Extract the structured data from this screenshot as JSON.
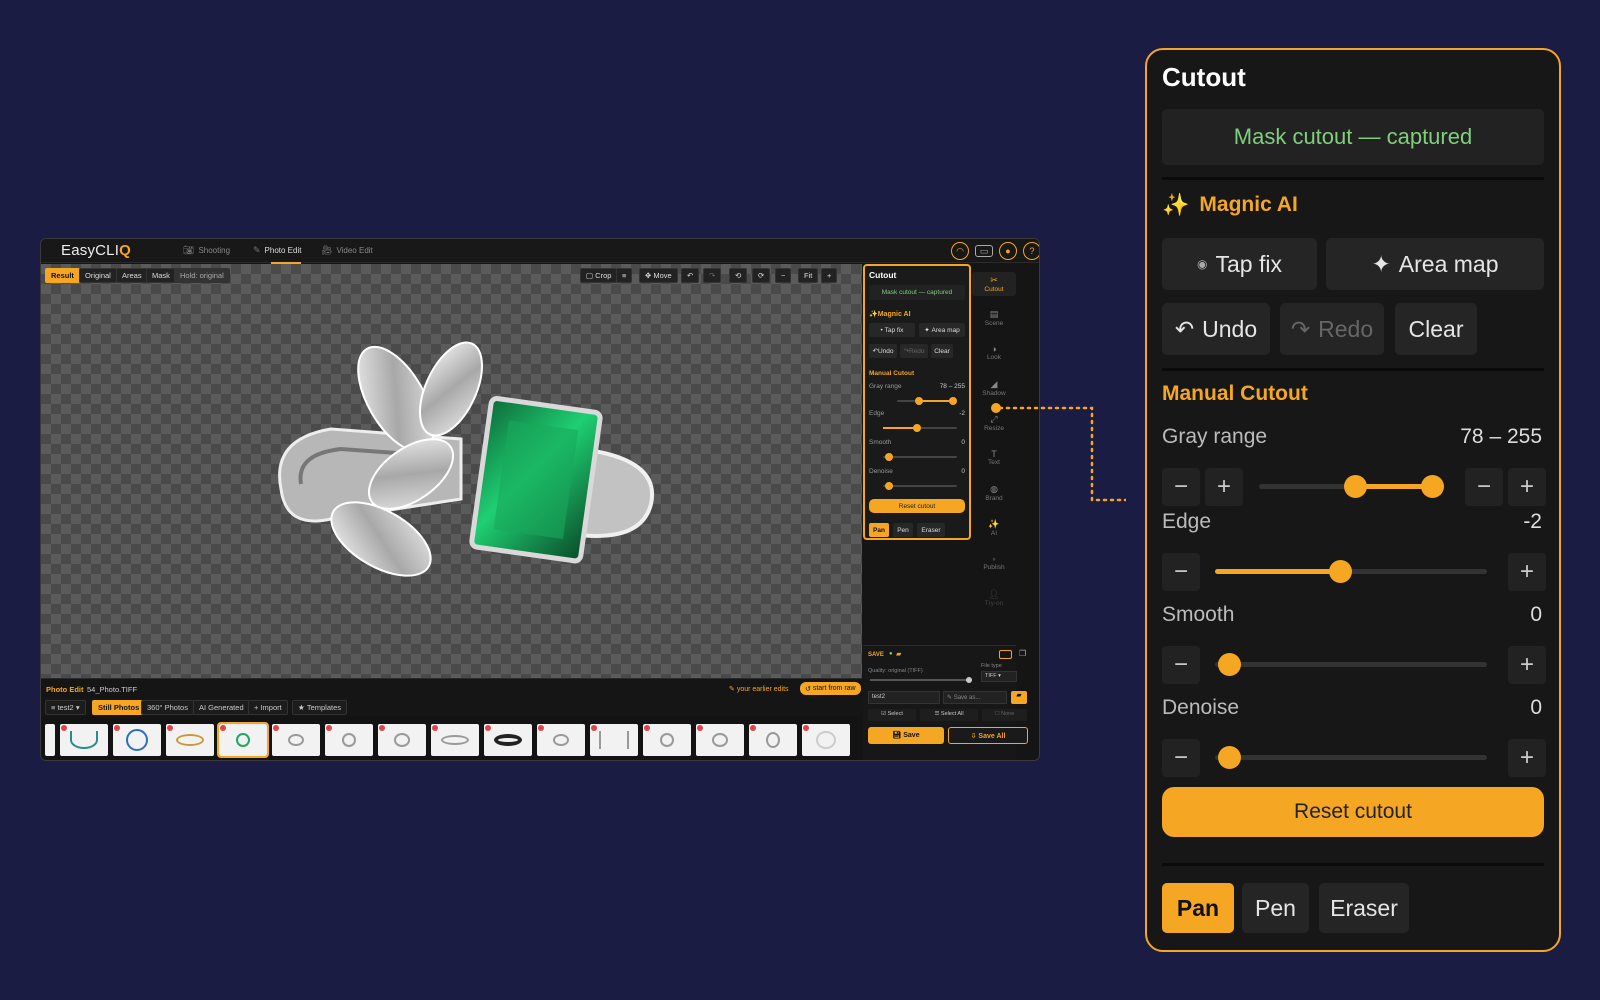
{
  "app": {
    "logo_text": "EasyCLI",
    "logo_accent": "Q",
    "nav": [
      {
        "label": "Shooting"
      },
      {
        "label": "Photo Edit"
      },
      {
        "label": "Video Edit"
      }
    ],
    "canvas_toolbar": {
      "result": "Result",
      "original": "Original",
      "areas": "Areas",
      "mask": "Mask",
      "hold_hint": "Hold: original",
      "crop": "Crop",
      "move": "Move",
      "fit": "Fit"
    },
    "info_bar": {
      "mode": "Photo Edit",
      "filename": "54_Photo.TIFF",
      "earlier_edits": "your earlier edits",
      "start_from_raw": "start from raw"
    },
    "filters": {
      "folder": "test2",
      "tabs": [
        "Still Photos",
        "360° Photos",
        "AI Generated",
        "Import",
        "Templates"
      ]
    },
    "mini_panel": {
      "title": "Cutout",
      "status": "Mask cutout — captured",
      "magic_ai": "Magnic AI",
      "tap_fix": "Tap fix",
      "area_map": "Area map",
      "undo": "Undo",
      "redo": "Redo",
      "clear": "Clear",
      "manual": "Manual Cutout",
      "gray_range": "Gray range",
      "gray_val": "78 – 255",
      "edge": "Edge",
      "edge_val": "-2",
      "smooth": "Smooth",
      "smooth_val": "0",
      "denoise": "Denoise",
      "denoise_val": "0",
      "reset": "Reset cutout",
      "pan": "Pan",
      "pen": "Pen",
      "eraser": "Eraser"
    },
    "sidebar": [
      "Cutout",
      "Scene",
      "Look",
      "Shadow",
      "Resize",
      "Text",
      "Brand",
      "AI",
      "Publish",
      "Try-on"
    ],
    "save_panel": {
      "title": "SAVE",
      "quality": "Quality: original (TIFF)",
      "file_type_label": "File type",
      "file_type": "TIFF",
      "folder": "test2",
      "save_as": "Save as...",
      "select": "Select",
      "select_all": "Select All",
      "none": "None",
      "save": "Save",
      "save_all": "Save All"
    }
  },
  "cutout_panel": {
    "title": "Cutout",
    "status": "Mask cutout — captured",
    "magic_ai": "Magnic AI",
    "tap_fix": "Tap fix",
    "area_map": "Area map",
    "undo": "Undo",
    "redo": "Redo",
    "clear": "Clear",
    "manual_title": "Manual Cutout",
    "gray_range": {
      "label": "Gray range",
      "value": "78 – 255",
      "low": 78,
      "high": 255,
      "min": 0,
      "max": 255
    },
    "edge": {
      "label": "Edge",
      "value": "-2"
    },
    "smooth": {
      "label": "Smooth",
      "value": "0"
    },
    "denoise": {
      "label": "Denoise",
      "value": "0"
    },
    "reset": "Reset cutout",
    "tools": [
      "Pan",
      "Pen",
      "Eraser"
    ],
    "active_tool": "Pan",
    "accent": "#f5a623",
    "status_color": "#7fcf7c"
  }
}
